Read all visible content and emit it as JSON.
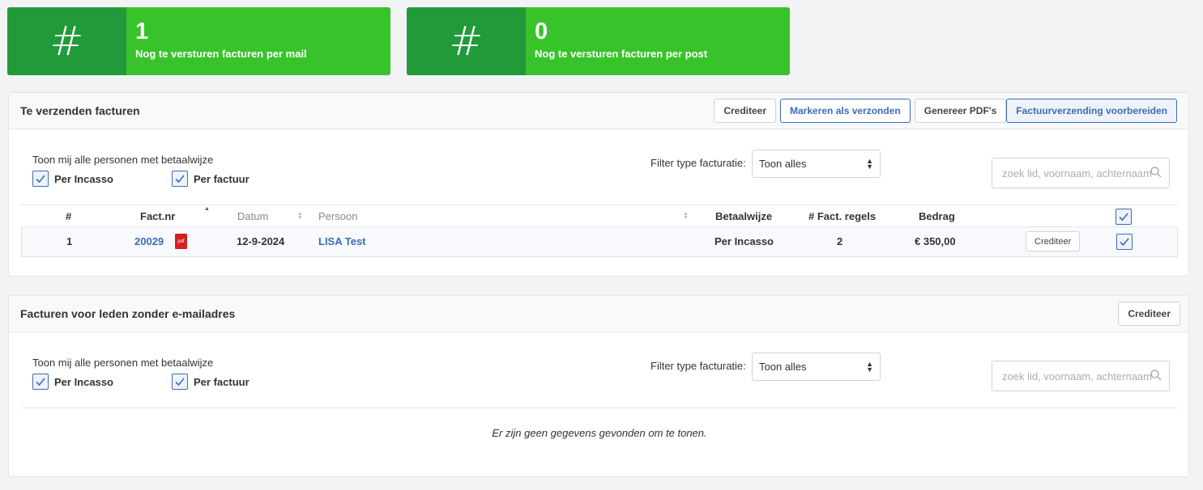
{
  "stats": [
    {
      "icon": "hash-icon",
      "glyph": "#",
      "value": "1",
      "label": "Nog te versturen facturen per mail"
    },
    {
      "icon": "hash-icon",
      "glyph": "#",
      "value": "0",
      "label": "Nog te versturen facturen per post"
    }
  ],
  "panel1": {
    "title": "Te verzenden facturen",
    "buttons": {
      "crediteer": "Crediteer",
      "markeren": "Markeren als verzonden",
      "genereer": "Genereer PDF's",
      "voorbereiden": "Factuurverzending voorbereiden"
    },
    "filter_label": "Toon mij alle personen met betaalwijze",
    "check_incasso": "Per Incasso",
    "check_factuur": "Per factuur",
    "type_label": "Filter type facturatie:",
    "type_value": "Toon alles",
    "search_placeholder": "zoek lid, voornaam, achternaam",
    "columns": {
      "nr": "#",
      "factnr": "Fact.nr",
      "datum": "Datum",
      "persoon": "Persoon",
      "betaalwijze": "Betaalwijze",
      "regels": "# Fact. regels",
      "bedrag": "Bedrag"
    },
    "rows": [
      {
        "nr": "1",
        "factnr": "20029",
        "pdf": "pdf",
        "datum": "12-9-2024",
        "persoon": "LISA Test",
        "betaalwijze": "Per Incasso",
        "regels": "2",
        "bedrag": "€ 350,00",
        "action": "Crediteer"
      }
    ]
  },
  "panel2": {
    "title": "Facturen voor leden zonder e-mailadres",
    "button": "Crediteer",
    "filter_label": "Toon mij alle personen met betaalwijze",
    "check_incasso": "Per Incasso",
    "check_factuur": "Per factuur",
    "type_label": "Filter type facturatie:",
    "type_value": "Toon alles",
    "search_placeholder": "zoek lid, voornaam, achternaam",
    "empty": "Er zijn geen gegevens gevonden om te tonen."
  },
  "colors": {
    "green": "#38c32b",
    "dark_green": "#219a3a",
    "primary": "#3d6cb5",
    "pdf_red": "#d32020"
  }
}
